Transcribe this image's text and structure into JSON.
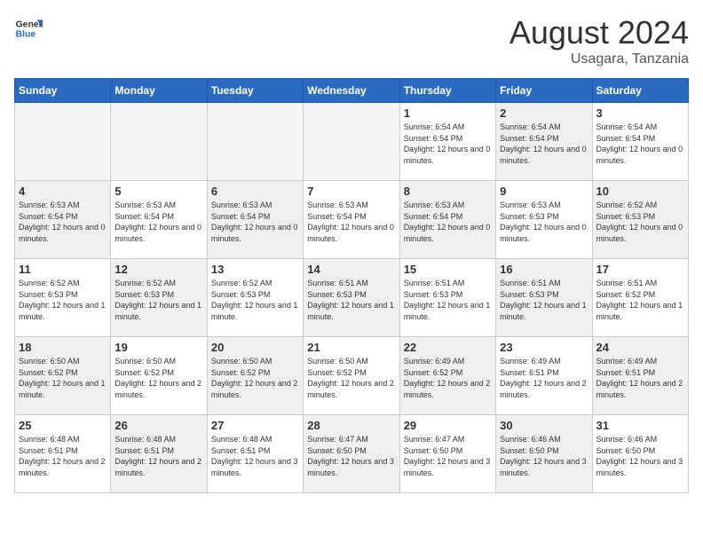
{
  "header": {
    "logo_general": "General",
    "logo_blue": "Blue",
    "month_title": "August 2024",
    "location": "Usagara, Tanzania"
  },
  "weekdays": [
    "Sunday",
    "Monday",
    "Tuesday",
    "Wednesday",
    "Thursday",
    "Friday",
    "Saturday"
  ],
  "weeks": [
    [
      {
        "day": "",
        "info": ""
      },
      {
        "day": "",
        "info": ""
      },
      {
        "day": "",
        "info": ""
      },
      {
        "day": "",
        "info": ""
      },
      {
        "day": "1",
        "info": "Sunrise: 6:54 AM\nSunset: 6:54 PM\nDaylight: 12 hours\nand 0 minutes."
      },
      {
        "day": "2",
        "info": "Sunrise: 6:54 AM\nSunset: 6:54 PM\nDaylight: 12 hours\nand 0 minutes."
      },
      {
        "day": "3",
        "info": "Sunrise: 6:54 AM\nSunset: 6:54 PM\nDaylight: 12 hours\nand 0 minutes."
      }
    ],
    [
      {
        "day": "4",
        "info": "Sunrise: 6:53 AM\nSunset: 6:54 PM\nDaylight: 12 hours\nand 0 minutes."
      },
      {
        "day": "5",
        "info": "Sunrise: 6:53 AM\nSunset: 6:54 PM\nDaylight: 12 hours\nand 0 minutes."
      },
      {
        "day": "6",
        "info": "Sunrise: 6:53 AM\nSunset: 6:54 PM\nDaylight: 12 hours\nand 0 minutes."
      },
      {
        "day": "7",
        "info": "Sunrise: 6:53 AM\nSunset: 6:54 PM\nDaylight: 12 hours\nand 0 minutes."
      },
      {
        "day": "8",
        "info": "Sunrise: 6:53 AM\nSunset: 6:54 PM\nDaylight: 12 hours\nand 0 minutes."
      },
      {
        "day": "9",
        "info": "Sunrise: 6:53 AM\nSunset: 6:53 PM\nDaylight: 12 hours\nand 0 minutes."
      },
      {
        "day": "10",
        "info": "Sunrise: 6:52 AM\nSunset: 6:53 PM\nDaylight: 12 hours\nand 0 minutes."
      }
    ],
    [
      {
        "day": "11",
        "info": "Sunrise: 6:52 AM\nSunset: 6:53 PM\nDaylight: 12 hours\nand 1 minute."
      },
      {
        "day": "12",
        "info": "Sunrise: 6:52 AM\nSunset: 6:53 PM\nDaylight: 12 hours\nand 1 minute."
      },
      {
        "day": "13",
        "info": "Sunrise: 6:52 AM\nSunset: 6:53 PM\nDaylight: 12 hours\nand 1 minute."
      },
      {
        "day": "14",
        "info": "Sunrise: 6:51 AM\nSunset: 6:53 PM\nDaylight: 12 hours\nand 1 minute."
      },
      {
        "day": "15",
        "info": "Sunrise: 6:51 AM\nSunset: 6:53 PM\nDaylight: 12 hours\nand 1 minute."
      },
      {
        "day": "16",
        "info": "Sunrise: 6:51 AM\nSunset: 6:53 PM\nDaylight: 12 hours\nand 1 minute."
      },
      {
        "day": "17",
        "info": "Sunrise: 6:51 AM\nSunset: 6:52 PM\nDaylight: 12 hours\nand 1 minute."
      }
    ],
    [
      {
        "day": "18",
        "info": "Sunrise: 6:50 AM\nSunset: 6:52 PM\nDaylight: 12 hours\nand 1 minute."
      },
      {
        "day": "19",
        "info": "Sunrise: 6:50 AM\nSunset: 6:52 PM\nDaylight: 12 hours\nand 2 minutes."
      },
      {
        "day": "20",
        "info": "Sunrise: 6:50 AM\nSunset: 6:52 PM\nDaylight: 12 hours\nand 2 minutes."
      },
      {
        "day": "21",
        "info": "Sunrise: 6:50 AM\nSunset: 6:52 PM\nDaylight: 12 hours\nand 2 minutes."
      },
      {
        "day": "22",
        "info": "Sunrise: 6:49 AM\nSunset: 6:52 PM\nDaylight: 12 hours\nand 2 minutes."
      },
      {
        "day": "23",
        "info": "Sunrise: 6:49 AM\nSunset: 6:51 PM\nDaylight: 12 hours\nand 2 minutes."
      },
      {
        "day": "24",
        "info": "Sunrise: 6:49 AM\nSunset: 6:51 PM\nDaylight: 12 hours\nand 2 minutes."
      }
    ],
    [
      {
        "day": "25",
        "info": "Sunrise: 6:48 AM\nSunset: 6:51 PM\nDaylight: 12 hours\nand 2 minutes."
      },
      {
        "day": "26",
        "info": "Sunrise: 6:48 AM\nSunset: 6:51 PM\nDaylight: 12 hours\nand 2 minutes."
      },
      {
        "day": "27",
        "info": "Sunrise: 6:48 AM\nSunset: 6:51 PM\nDaylight: 12 hours\nand 3 minutes."
      },
      {
        "day": "28",
        "info": "Sunrise: 6:47 AM\nSunset: 6:50 PM\nDaylight: 12 hours\nand 3 minutes."
      },
      {
        "day": "29",
        "info": "Sunrise: 6:47 AM\nSunset: 6:50 PM\nDaylight: 12 hours\nand 3 minutes."
      },
      {
        "day": "30",
        "info": "Sunrise: 6:46 AM\nSunset: 6:50 PM\nDaylight: 12 hours\nand 3 minutes."
      },
      {
        "day": "31",
        "info": "Sunrise: 6:46 AM\nSunset: 6:50 PM\nDaylight: 12 hours\nand 3 minutes."
      }
    ]
  ]
}
